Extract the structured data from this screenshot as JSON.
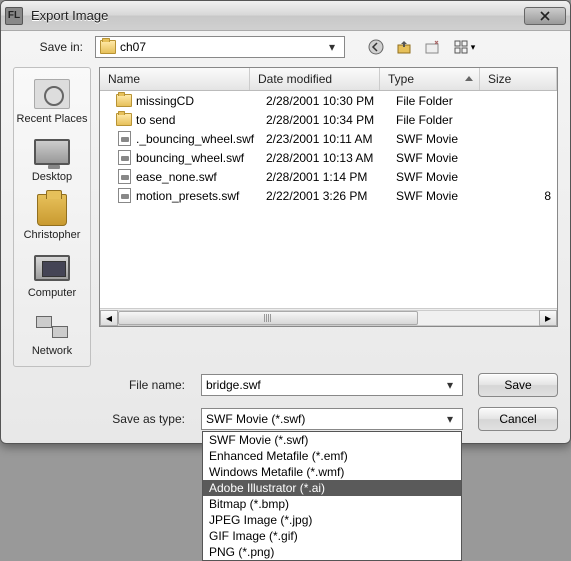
{
  "window": {
    "title": "Export Image"
  },
  "toolbar": {
    "save_in_label": "Save in:",
    "current_folder": "ch07"
  },
  "places": [
    {
      "label": "Recent Places",
      "icon": "recent"
    },
    {
      "label": "Desktop",
      "icon": "desktop"
    },
    {
      "label": "Christopher",
      "icon": "user"
    },
    {
      "label": "Computer",
      "icon": "computer"
    },
    {
      "label": "Network",
      "icon": "network"
    }
  ],
  "columns": {
    "name": "Name",
    "date": "Date modified",
    "type": "Type",
    "size": "Size"
  },
  "files": [
    {
      "name": "missingCD",
      "date": "2/28/2001 10:30 PM",
      "type": "File Folder",
      "size": "",
      "icon": "folder"
    },
    {
      "name": "to send",
      "date": "2/28/2001 10:34 PM",
      "type": "File Folder",
      "size": "",
      "icon": "folder"
    },
    {
      "name": "._bouncing_wheel.swf",
      "date": "2/23/2001 10:11 AM",
      "type": "SWF Movie",
      "size": "",
      "icon": "swf"
    },
    {
      "name": "bouncing_wheel.swf",
      "date": "2/28/2001 10:13 AM",
      "type": "SWF Movie",
      "size": "",
      "icon": "swf"
    },
    {
      "name": "ease_none.swf",
      "date": "2/28/2001 1:14 PM",
      "type": "SWF Movie",
      "size": "",
      "icon": "swf"
    },
    {
      "name": "motion_presets.swf",
      "date": "2/22/2001 3:26 PM",
      "type": "SWF Movie",
      "size": "8",
      "icon": "swf"
    }
  ],
  "form": {
    "filename_label": "File name:",
    "filename_value": "bridge.swf",
    "type_label": "Save as type:",
    "type_value": "SWF Movie (*.swf)"
  },
  "type_options": [
    {
      "label": "SWF Movie (*.swf)",
      "selected": false
    },
    {
      "label": "Enhanced Metafile (*.emf)",
      "selected": false
    },
    {
      "label": "Windows Metafile (*.wmf)",
      "selected": false
    },
    {
      "label": "Adobe Illustrator (*.ai)",
      "selected": true
    },
    {
      "label": "Bitmap (*.bmp)",
      "selected": false
    },
    {
      "label": "JPEG Image (*.jpg)",
      "selected": false
    },
    {
      "label": "GIF Image (*.gif)",
      "selected": false
    },
    {
      "label": "PNG (*.png)",
      "selected": false
    }
  ],
  "buttons": {
    "save": "Save",
    "cancel": "Cancel"
  }
}
